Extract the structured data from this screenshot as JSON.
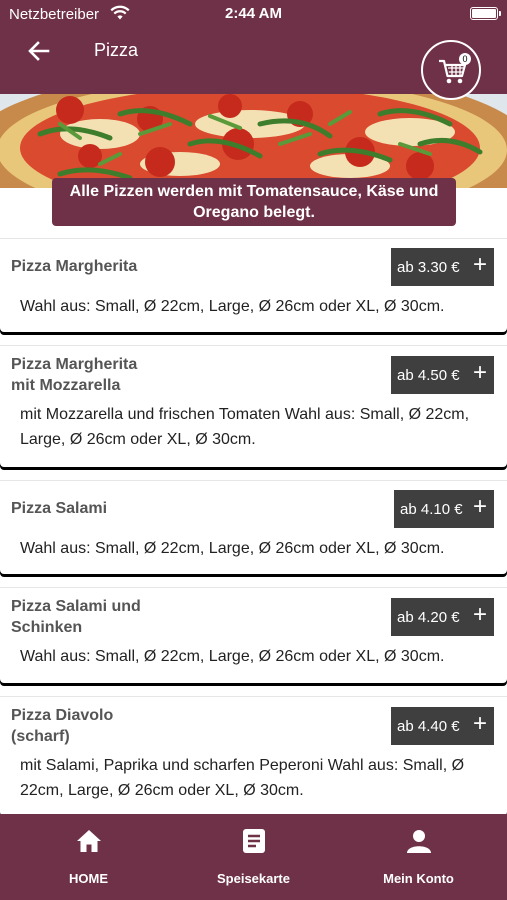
{
  "status_bar": {
    "carrier": "Netzbetreiber",
    "time": "2:44 AM"
  },
  "header": {
    "title": "Pizza",
    "cart_count": "0",
    "back_icon": "arrow-left-icon",
    "cart_icon": "shopping-cart-icon"
  },
  "colors": {
    "brand": "#6f3147",
    "price_button": "#3f3f3f"
  },
  "notice": "Alle Pizzen werden mit Tomatensauce, Käse und Oregano belegt.",
  "items": [
    {
      "name_line1": "Pizza Margherita",
      "name_line2": "",
      "price": "ab 3.30 €",
      "desc_line1": "Wahl aus: Small, Ø 22cm, Large, Ø 26cm oder XL, Ø 30cm.",
      "desc_line2": ""
    },
    {
      "name_line1": "Pizza Margherita",
      "name_line2": "mit Mozzarella",
      "price": "ab 4.50 €",
      "desc_line1": "mit Mozzarella und frischen Tomaten Wahl aus: Small, Ø 22cm,",
      "desc_line2": "Large, Ø 26cm oder XL, Ø 30cm."
    },
    {
      "name_line1": "Pizza Salami",
      "name_line2": "",
      "price": "ab 4.10 €",
      "desc_line1": "Wahl aus: Small, Ø 22cm, Large, Ø 26cm oder XL, Ø 30cm.",
      "desc_line2": ""
    },
    {
      "name_line1": "Pizza Salami und",
      "name_line2": "Schinken",
      "price": "ab 4.20 €",
      "desc_line1": "Wahl aus: Small, Ø 22cm, Large, Ø 26cm oder XL, Ø 30cm.",
      "desc_line2": ""
    },
    {
      "name_line1": "Pizza Diavolo",
      "name_line2": "(scharf)",
      "price": "ab 4.40 €",
      "desc_line1": "mit Salami, Paprika und scharfen Peperoni Wahl aus: Small, Ø",
      "desc_line2": "22cm, Large, Ø 26cm oder XL, Ø 30cm."
    }
  ],
  "plus_symbol": "+",
  "nav": [
    {
      "label": "HOME",
      "icon": "home-icon"
    },
    {
      "label": "Speisekarte",
      "icon": "menu-list-icon"
    },
    {
      "label": "Mein Konto",
      "icon": "user-icon"
    }
  ]
}
